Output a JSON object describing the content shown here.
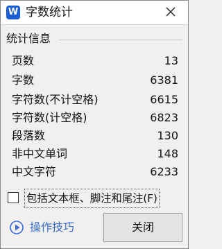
{
  "window": {
    "title": "字数统计",
    "app_icon_letter": "W",
    "close_icon": "close-icon"
  },
  "section": {
    "title": "统计信息"
  },
  "stats": [
    {
      "label": "页数",
      "value": "13"
    },
    {
      "label": "字数",
      "value": "6381"
    },
    {
      "label": "字符数(不计空格)",
      "value": "6615"
    },
    {
      "label": "字符数(计空格)",
      "value": "6823"
    },
    {
      "label": "段落数",
      "value": "130"
    },
    {
      "label": "非中文单词",
      "value": "148"
    },
    {
      "label": "中文字符",
      "value": "6233"
    }
  ],
  "options": {
    "include_textboxes_label": "包括文本框、脚注和尾注(F)",
    "include_textboxes_checked": false
  },
  "footer": {
    "tips_label": "操作技巧",
    "tips_icon": "play-circle-icon",
    "close_label": "关闭"
  },
  "colors": {
    "app_icon": "#1a5fd6",
    "link": "#3b6fd0",
    "background": "#f0f0f0",
    "titlebar": "#ffffff"
  }
}
